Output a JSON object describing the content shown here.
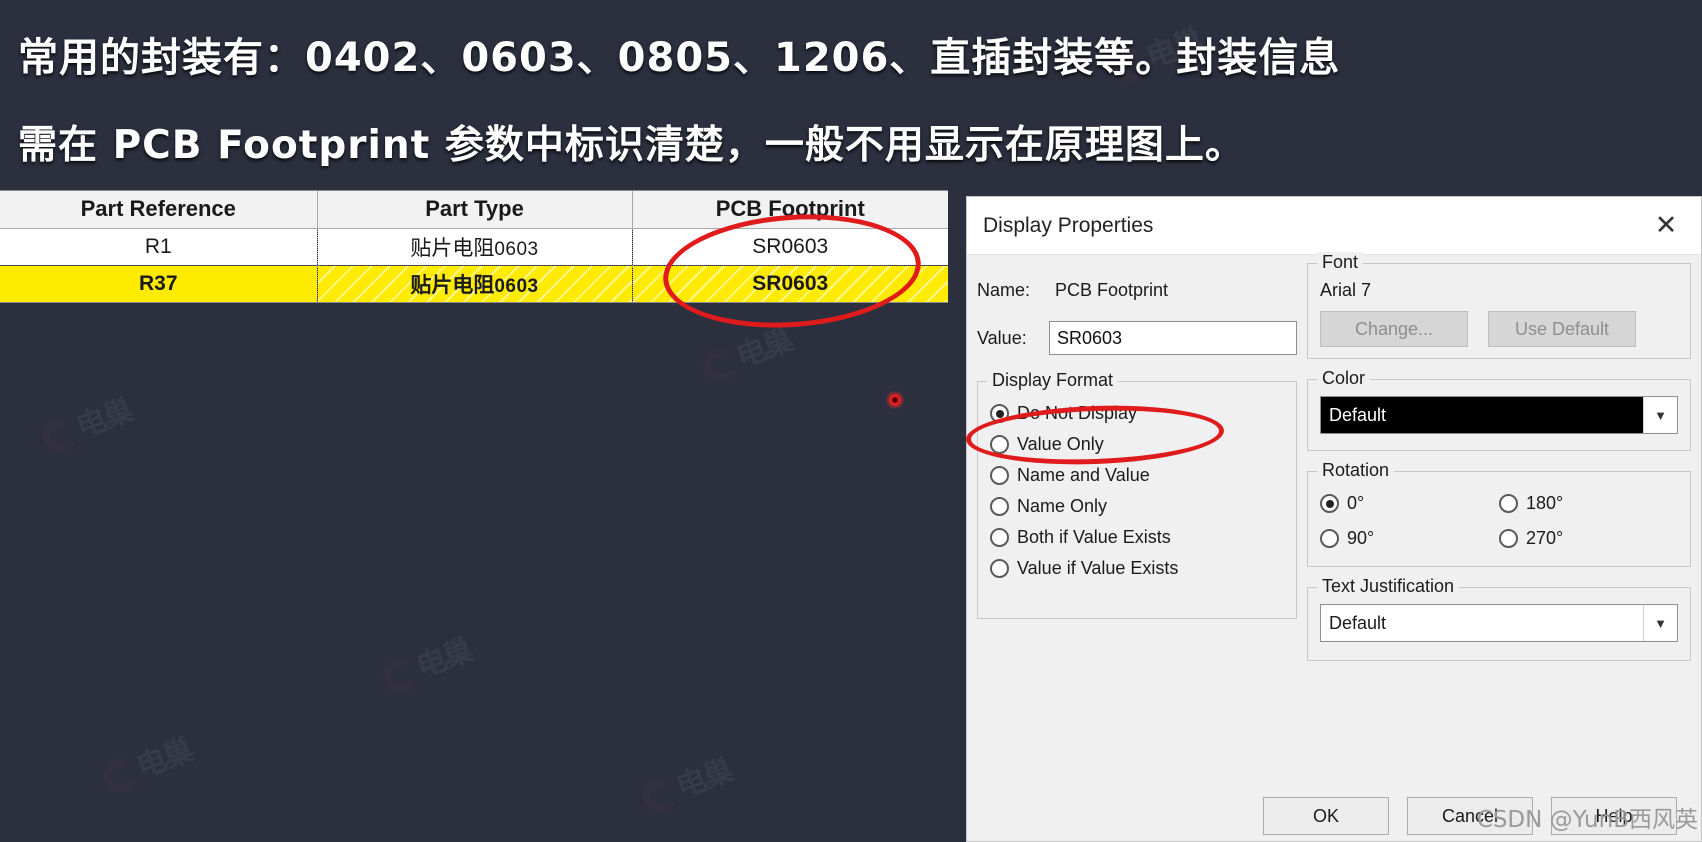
{
  "headline": {
    "line1": "常用的封装有：0402、0603、0805、1206、直插封装等。封装信息",
    "line2": "需在 PCB Footprint 参数中标识清楚，一般不用显示在原理图上。"
  },
  "table": {
    "headers": [
      "Part Reference",
      "Part Type",
      "PCB Footprint"
    ],
    "rows": [
      {
        "ref": "R1",
        "type_cn": "贴片电阻",
        "type_num": "0603",
        "footprint": "SR0603",
        "selected": false
      },
      {
        "ref": "R37",
        "type_cn": "贴片电阻",
        "type_num": "0603",
        "footprint": "SR0603",
        "selected": true
      }
    ]
  },
  "dialog": {
    "title": "Display Properties",
    "close_label": "✕",
    "name_label": "Name:",
    "name_value": "PCB Footprint",
    "value_label": "Value:",
    "value_text": "SR0603",
    "display_format": {
      "legend": "Display Format",
      "options": [
        {
          "label": "Do Not Display",
          "selected": true
        },
        {
          "label": "Value Only",
          "selected": false
        },
        {
          "label": "Name and Value",
          "selected": false
        },
        {
          "label": "Name Only",
          "selected": false
        },
        {
          "label": "Both if Value Exists",
          "selected": false
        },
        {
          "label": "Value if Value Exists",
          "selected": false
        }
      ]
    },
    "font": {
      "legend": "Font",
      "name": "Arial 7",
      "change_label": "Change...",
      "use_default_label": "Use Default"
    },
    "color": {
      "legend": "Color",
      "selected": "Default",
      "swatch_hex": "#000000"
    },
    "rotation": {
      "legend": "Rotation",
      "options": [
        {
          "label": "0°",
          "selected": true
        },
        {
          "label": "180°",
          "selected": false
        },
        {
          "label": "90°",
          "selected": false
        },
        {
          "label": "270°",
          "selected": false
        }
      ]
    },
    "justification": {
      "legend": "Text Justification",
      "selected": "Default"
    },
    "buttons": {
      "ok": "OK",
      "cancel": "Cancel",
      "help": "Help"
    }
  },
  "annotations": {
    "ellipse_footprint": "red-ellipse-around-pcb-footprint-column",
    "ellipse_do_not_display": "red-ellipse-around-do-not-display",
    "cursor_dot": "red-laser-pointer-dot"
  },
  "watermarks": {
    "site": "电巢",
    "csdn": "CSDN @YunB西风英"
  },
  "colors": {
    "background": "#2b2f3e",
    "highlight_row": "#ffeb00",
    "annotation_red": "#e01b1b",
    "dialog_bg": "#f0f0f0"
  }
}
